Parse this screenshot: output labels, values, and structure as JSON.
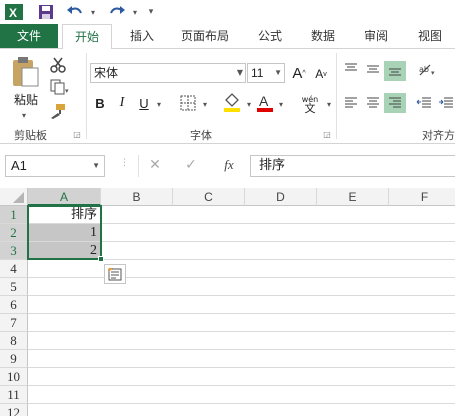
{
  "qat": {
    "excel_icon": "excel-logo-icon",
    "save": "save-icon",
    "undo": "undo-icon",
    "redo": "redo-icon",
    "more": "customize-qat-icon"
  },
  "tabs": [
    {
      "label": "文件"
    },
    {
      "label": "开始"
    },
    {
      "label": "插入"
    },
    {
      "label": "页面布局"
    },
    {
      "label": "公式"
    },
    {
      "label": "数据"
    },
    {
      "label": "审阅"
    },
    {
      "label": "视图"
    }
  ],
  "ribbon": {
    "clipboard": {
      "paste_label": "粘贴",
      "group_label": "剪贴板"
    },
    "font": {
      "font_name": "宋体",
      "font_size": "11",
      "bold": "B",
      "italic": "I",
      "underline": "U",
      "increase": "A",
      "decrease": "A",
      "phonetic_top": "wén",
      "phonetic_bottom": "文",
      "font_color_letter": "A",
      "group_label": "字体"
    },
    "alignment": {
      "group_label": "对齐方"
    }
  },
  "formula_bar": {
    "name_box": "A1",
    "fx": "fx",
    "value": "排序"
  },
  "grid": {
    "columns": [
      "A",
      "B",
      "C",
      "D",
      "E",
      "F"
    ],
    "rows": [
      "1",
      "2",
      "3",
      "4",
      "5",
      "6",
      "7",
      "8",
      "9",
      "10",
      "11",
      "12"
    ],
    "cells": {
      "A1": "排序",
      "A2": "1",
      "A3": "2"
    }
  },
  "colors": {
    "accent": "#217346",
    "selection": "#c6c6c6",
    "highlight": "#a9d3b7"
  }
}
